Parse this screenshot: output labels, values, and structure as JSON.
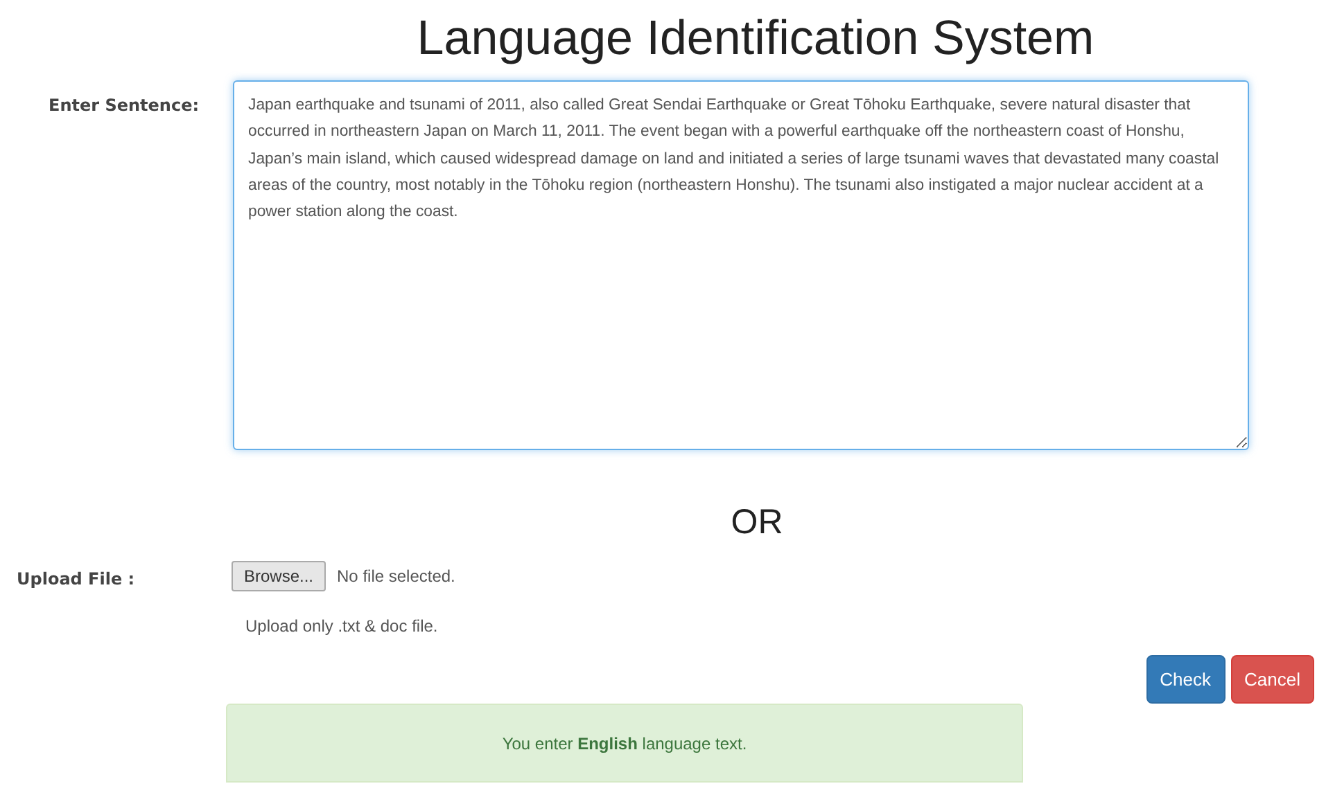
{
  "title": "Language Identification System",
  "sentence": {
    "label": "Enter Sentence:",
    "value": "Japan earthquake and tsunami of 2011, also called Great Sendai Earthquake or Great Tōhoku Earthquake, severe natural disaster that occurred in northeastern Japan on March 11, 2011. The event began with a powerful earthquake off the northeastern coast of Honshu, Japan’s main island, which caused widespread damage on land and initiated a series of large tsunami waves that devastated many coastal areas of the country, most notably in the Tōhoku region (northeastern Honshu). The tsunami also instigated a major nuclear accident at a power station along the coast."
  },
  "separator": "OR",
  "upload": {
    "label": "Upload File :",
    "button": "Browse...",
    "status": "No file selected.",
    "hint": "Upload only .txt & doc file."
  },
  "buttons": [
    {
      "label": "Check",
      "kind": "primary"
    },
    {
      "label": "Cancel",
      "kind": "danger"
    }
  ],
  "result": "You enter **English** language text."
}
